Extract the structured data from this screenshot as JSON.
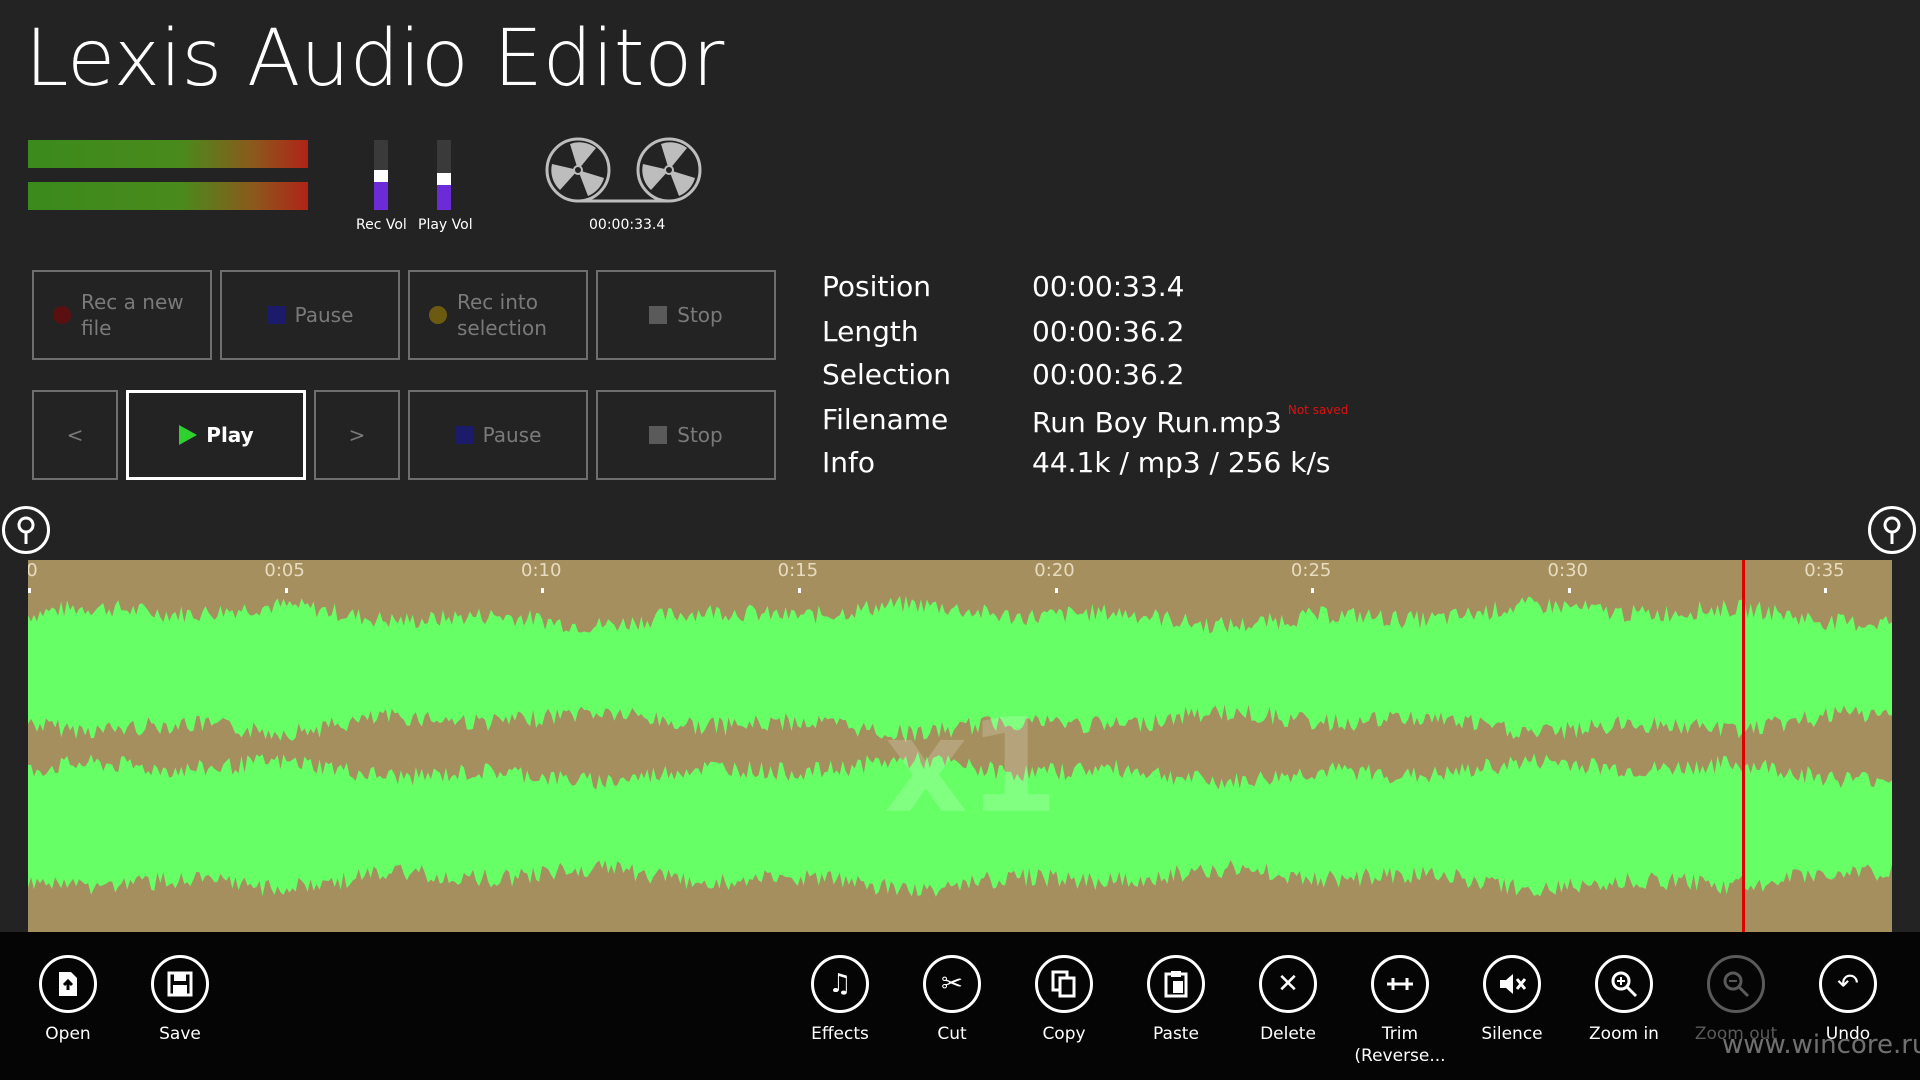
{
  "app": {
    "title": "Lexis Audio Editor"
  },
  "meters": {
    "rec_vol_label": "Rec Vol",
    "play_vol_label": "Play Vol",
    "rec_vol_level": 0.4,
    "play_vol_level": 0.35
  },
  "reels": {
    "time": "00:00:33.4"
  },
  "record_row": {
    "rec_new": "Rec a new file",
    "pause": "Pause",
    "rec_selection": "Rec into selection",
    "stop": "Stop"
  },
  "play_row": {
    "prev": "<",
    "play": "Play",
    "next": ">",
    "pause": "Pause",
    "stop": "Stop"
  },
  "info": {
    "position_label": "Position",
    "position": "00:00:33.4",
    "length_label": "Length",
    "length": "00:00:36.2",
    "selection_label": "Selection",
    "selection": "00:00:36.2",
    "filename_label": "Filename",
    "filename": "Run Boy Run.mp3",
    "not_saved": "Not saved",
    "info_label": "Info",
    "info": "44.1k / mp3 / 256 k/s"
  },
  "waveform": {
    "zoom_label": "x1",
    "ticks": [
      "0",
      "0:05",
      "0:10",
      "0:15",
      "0:20",
      "0:25",
      "0:30",
      "0:35"
    ],
    "duration_seconds": 36.2,
    "playhead_seconds": 33.4,
    "colors": {
      "background": "#a58f5e",
      "wave": "#66ff66",
      "playhead": "#e00000"
    }
  },
  "appbar": {
    "open": "Open",
    "save": "Save",
    "effects": "Effects",
    "cut": "Cut",
    "copy": "Copy",
    "paste": "Paste",
    "delete": "Delete",
    "trim": "Trim (Reverse...",
    "silence": "Silence",
    "zoom_in": "Zoom in",
    "zoom_out": "Zoom out",
    "undo": "Undo"
  },
  "watermark": "www.wincore.ru"
}
